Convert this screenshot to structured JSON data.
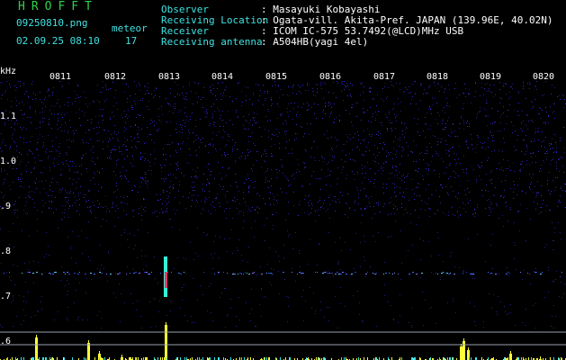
{
  "header": {
    "title": "HROFFT",
    "filename": "09250810.png",
    "meteor_label": "meteor",
    "datetime": "02.09.25 08:10",
    "meteor_count": "17"
  },
  "info": {
    "labels": [
      "Observer",
      "Receiving Location",
      "Receiver",
      "Receiving antenna"
    ],
    "values": [
      ": Masayuki Kobayashi",
      ": Ogata-vill. Akita-Pref. JAPAN (139.96E, 40.02N)",
      ": ICOM IC-575 53.7492(@LCD)MHz USB",
      ": A504HB(yagi 4el)"
    ]
  },
  "time_ticks": [
    "0811",
    "0812",
    "0813",
    "0814",
    "0815",
    "0816",
    "0817",
    "0818",
    "0819",
    "0820"
  ],
  "freq_unit": "kHz",
  "freq_ticks": [
    "1.1",
    "1.0",
    ".9",
    ".8",
    ".7",
    ".6"
  ],
  "colors": {
    "title": "#2fd24b",
    "labels": "#3fe2e2",
    "values": "#ffffff",
    "bars": "#ffff33",
    "noise": "#1a1ab4"
  }
}
